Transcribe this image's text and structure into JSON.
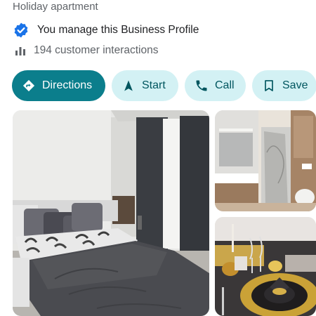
{
  "business": {
    "category": "Holiday apartment",
    "verified_text": "You manage this Business Profile",
    "interactions_text": "194 customer interactions"
  },
  "actions": [
    {
      "label": "Directions",
      "icon": "directions-icon"
    },
    {
      "label": "Start",
      "icon": "navigation-arrow-icon"
    },
    {
      "label": "Call",
      "icon": "phone-icon"
    },
    {
      "label": "Save",
      "icon": "bookmark-icon"
    }
  ],
  "colors": {
    "primary_chip": "#0b7e8c",
    "secondary_chip": "#d3f1f4",
    "secondary_chip_text": "#00565f",
    "verified_badge": "#1a73e8"
  },
  "photos": [
    {
      "subject": "bedroom"
    },
    {
      "subject": "bathroom"
    },
    {
      "subject": "dining-table-setting"
    }
  ]
}
